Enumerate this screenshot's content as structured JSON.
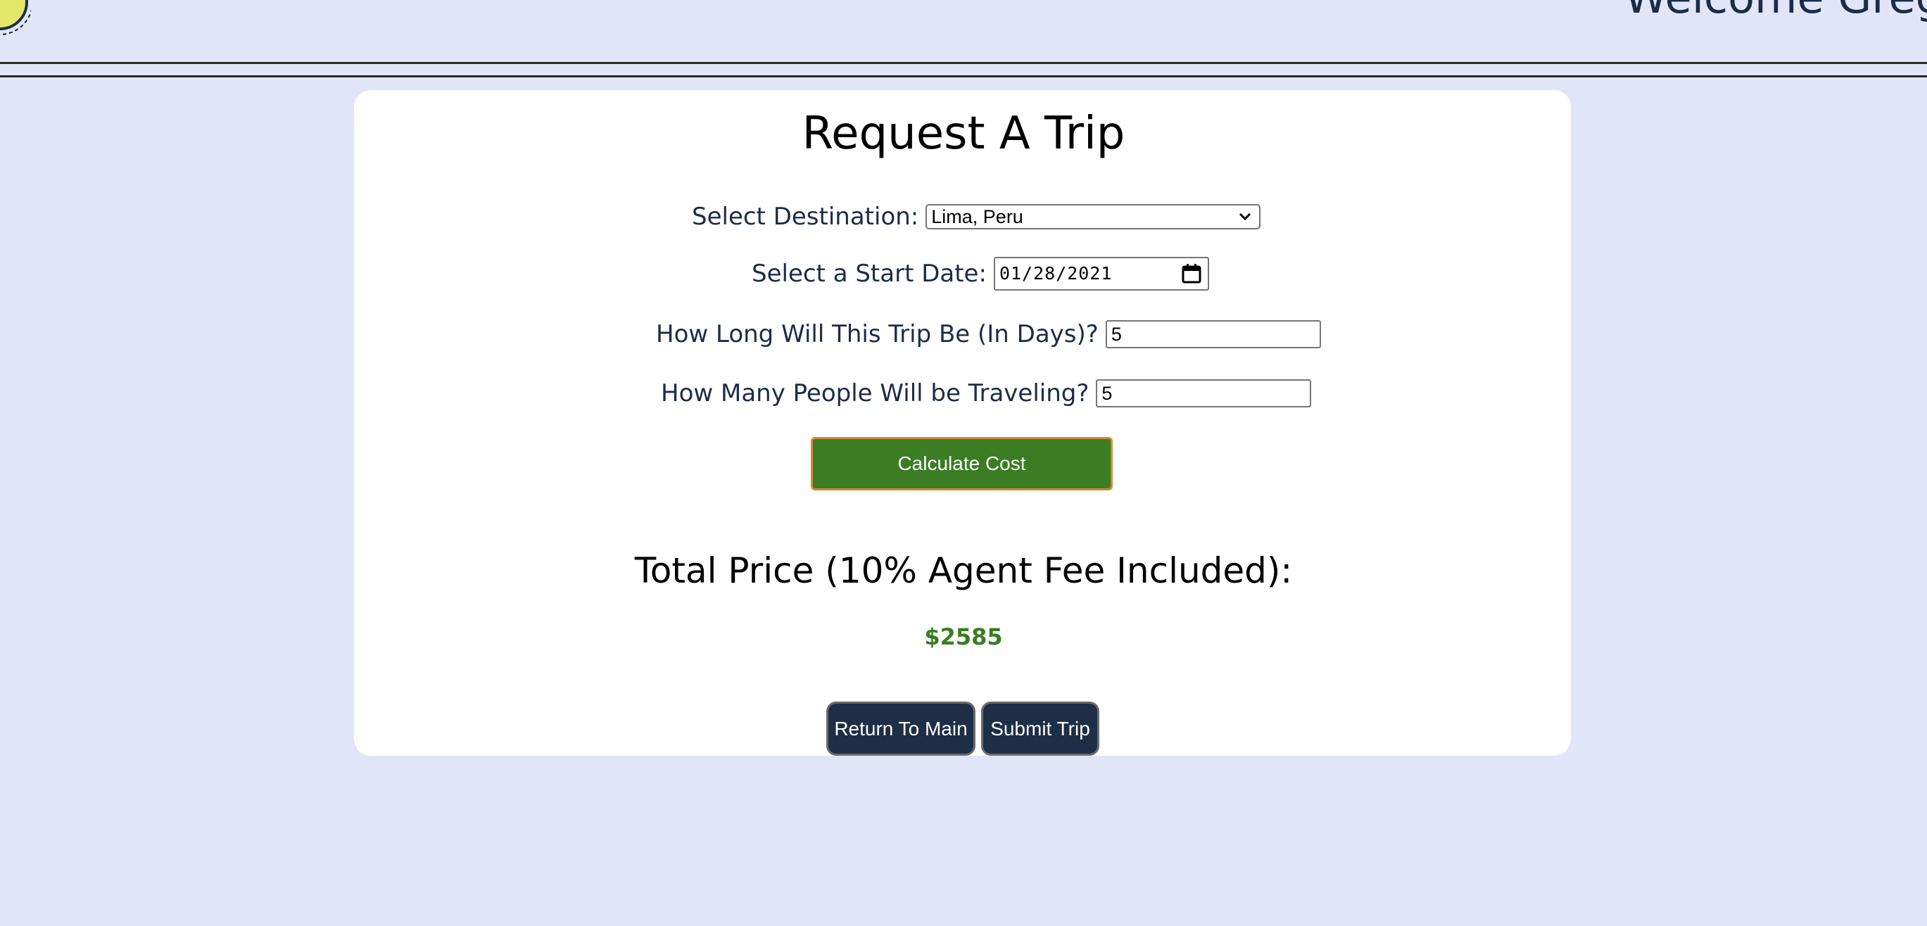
{
  "header": {
    "welcome_text": "Welcome Greg"
  },
  "page": {
    "title": "Request A Trip"
  },
  "form": {
    "destination_label": "Select Destination:",
    "destination_value": "Lima, Peru",
    "start_date_label": "Select a Start Date:",
    "start_date_value": "01/28/2021",
    "duration_label": "How Long Will This Trip Be (In Days)?",
    "duration_value": "5",
    "travelers_label": "How Many People Will be Traveling?",
    "travelers_value": "5",
    "calculate_label": "Calculate Cost"
  },
  "result": {
    "heading": "Total Price (10% Agent Fee Included):",
    "value": "$2585"
  },
  "actions": {
    "return_label": "Return To Main",
    "submit_label": "Submit Trip"
  },
  "colors": {
    "background": "#e0e6f7",
    "accent_green": "#3a7d23",
    "button_navy": "#1f2e47",
    "calc_border": "#d28a3c"
  }
}
